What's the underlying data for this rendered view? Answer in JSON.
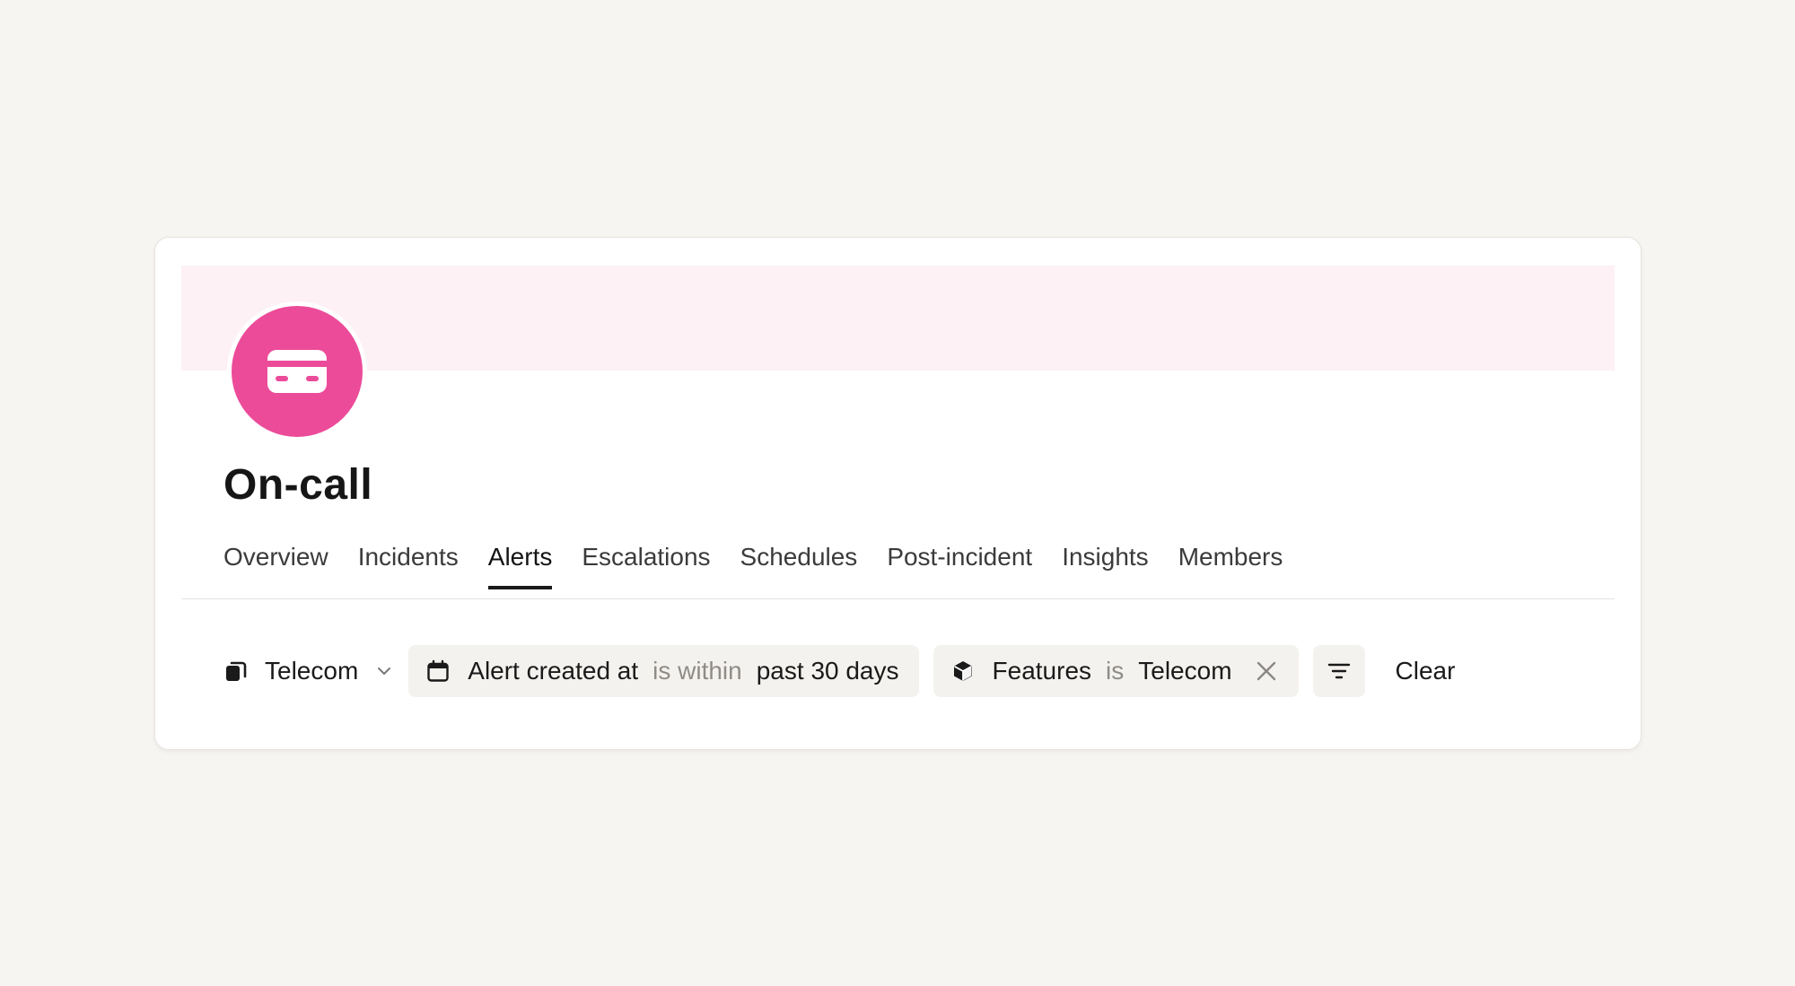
{
  "header": {
    "icon": "credit-card-icon",
    "title": "On-call",
    "accent_color": "#ec4b9a",
    "banner_color": "#fdf1f6"
  },
  "tabs": [
    {
      "label": "Overview",
      "active": false
    },
    {
      "label": "Incidents",
      "active": false
    },
    {
      "label": "Alerts",
      "active": true
    },
    {
      "label": "Escalations",
      "active": false
    },
    {
      "label": "Schedules",
      "active": false
    },
    {
      "label": "Post-incident",
      "active": false
    },
    {
      "label": "Insights",
      "active": false
    },
    {
      "label": "Members",
      "active": false
    }
  ],
  "filters": {
    "scope": {
      "label": "Telecom",
      "icon": "cards-stack-icon"
    },
    "date_filter": {
      "field": "Alert created at",
      "operator": "is within",
      "value": "past 30 days",
      "icon": "calendar-icon"
    },
    "feature_filter": {
      "field": "Features",
      "operator": "is",
      "value": "Telecom",
      "icon": "cube-icon"
    },
    "filter_button_icon": "filter-lines-icon",
    "clear_label": "Clear"
  }
}
